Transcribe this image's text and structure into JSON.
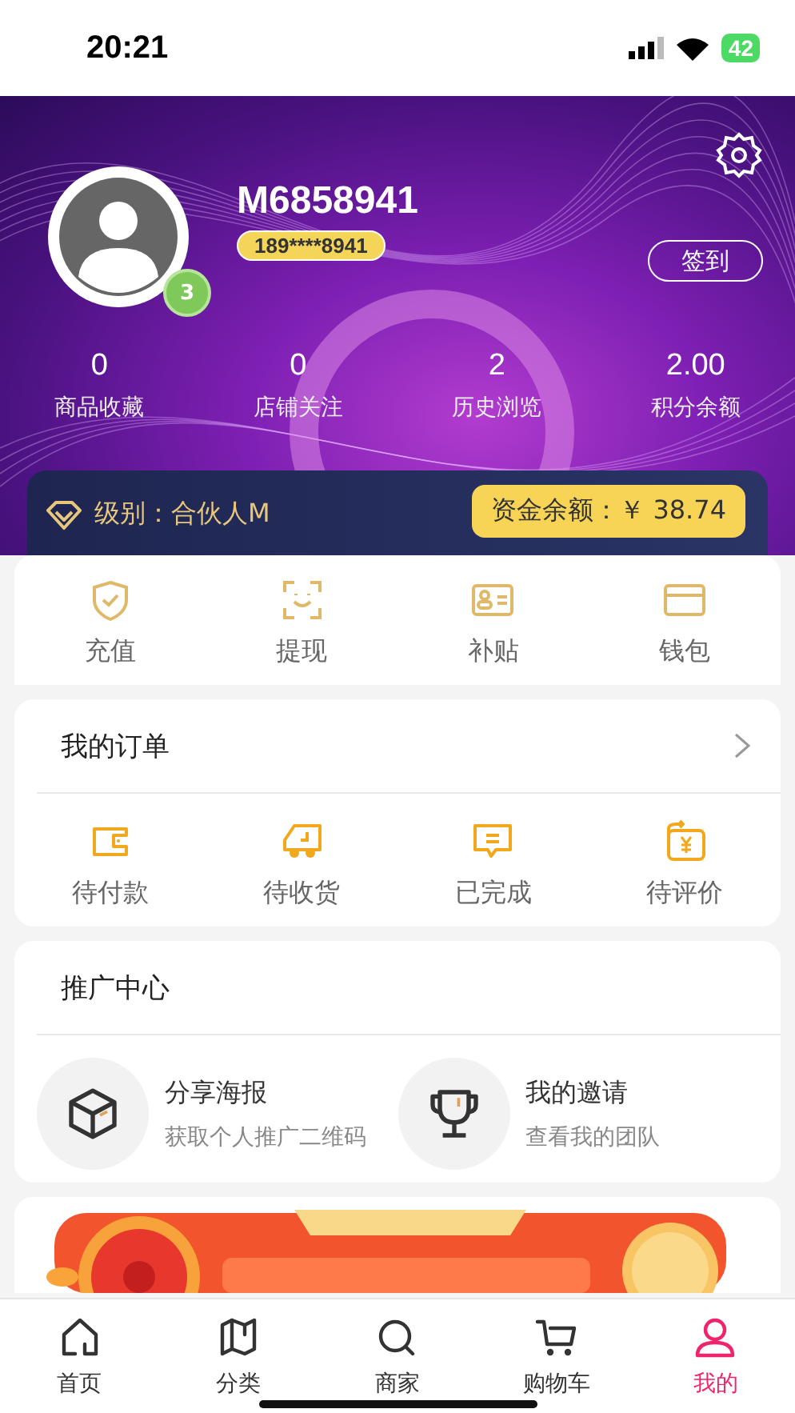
{
  "status_bar": {
    "time": "20:21",
    "battery": "42"
  },
  "profile": {
    "username": "M6858941",
    "phone": "189****8941",
    "level_badge": "3",
    "checkin_button": "签到"
  },
  "stats": [
    {
      "value": "0",
      "label": "商品收藏"
    },
    {
      "value": "0",
      "label": "店铺关注"
    },
    {
      "value": "2",
      "label": "历史浏览"
    },
    {
      "value": "2.00",
      "label": "积分余额"
    }
  ],
  "member_bar": {
    "level": "级别：合伙人M",
    "balance": "资金余额：￥ 38.74"
  },
  "wallet_actions": [
    {
      "kind": "shield",
      "label": "充值"
    },
    {
      "kind": "face",
      "label": "提现"
    },
    {
      "kind": "card",
      "label": "补贴"
    },
    {
      "kind": "wallet",
      "label": "钱包"
    }
  ],
  "orders": {
    "title": "我的订单",
    "items": [
      {
        "kind": "pay",
        "label": "待付款"
      },
      {
        "kind": "truck",
        "label": "待收货"
      },
      {
        "kind": "chat",
        "label": "已完成"
      },
      {
        "kind": "yen",
        "label": "待评价"
      }
    ]
  },
  "promotion": {
    "title": "推广中心",
    "items": [
      {
        "kind": "box",
        "title": "分享海报",
        "subtitle": "获取个人推广二维码"
      },
      {
        "kind": "trophy",
        "title": "我的邀请",
        "subtitle": "查看我的团队"
      }
    ]
  },
  "tab_bar": [
    {
      "kind": "home",
      "label": "首页",
      "selected": false
    },
    {
      "kind": "map",
      "label": "分类",
      "selected": false
    },
    {
      "kind": "search",
      "label": "商家",
      "selected": false
    },
    {
      "kind": "cart",
      "label": "购物车",
      "selected": false
    },
    {
      "kind": "user",
      "label": "我的",
      "selected": true
    }
  ]
}
